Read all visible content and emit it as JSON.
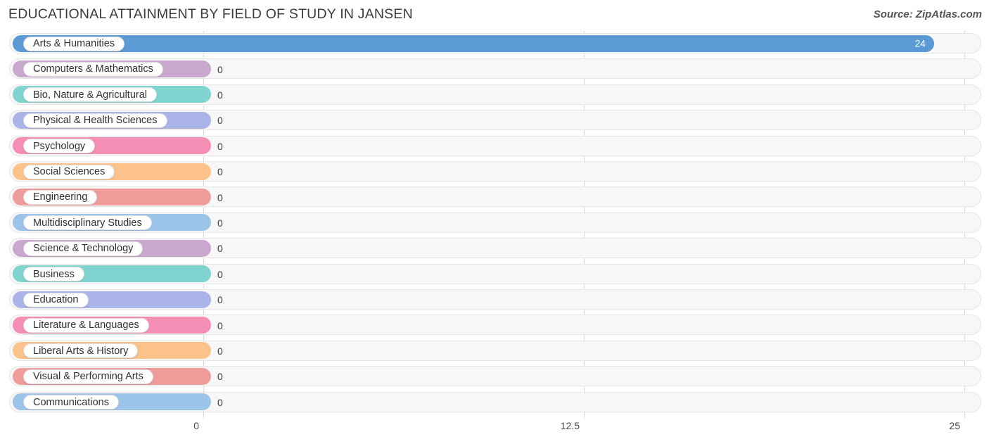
{
  "header": {
    "title": "EDUCATIONAL ATTAINMENT BY FIELD OF STUDY IN JANSEN",
    "source": "Source: ZipAtlas.com"
  },
  "chart_data": {
    "type": "bar",
    "orientation": "horizontal",
    "title": "EDUCATIONAL ATTAINMENT BY FIELD OF STUDY IN JANSEN",
    "xlabel": "",
    "ylabel": "",
    "xlim": [
      0,
      25
    ],
    "xticks": [
      "0",
      "12.5",
      "25"
    ],
    "xtick_values": [
      0,
      12.5,
      25
    ],
    "grid": true,
    "legend": "none",
    "categories": [
      "Arts & Humanities",
      "Computers & Mathematics",
      "Bio, Nature & Agricultural",
      "Physical & Health Sciences",
      "Psychology",
      "Social Sciences",
      "Engineering",
      "Multidisciplinary Studies",
      "Science & Technology",
      "Business",
      "Education",
      "Literature & Languages",
      "Liberal Arts & History",
      "Visual & Performing Arts",
      "Communications"
    ],
    "values": [
      24,
      0,
      0,
      0,
      0,
      0,
      0,
      0,
      0,
      0,
      0,
      0,
      0,
      0,
      0
    ],
    "value_labels": [
      "24",
      "0",
      "0",
      "0",
      "0",
      "0",
      "0",
      "0",
      "0",
      "0",
      "0",
      "0",
      "0",
      "0",
      "0"
    ],
    "bar_colors": [
      "#5b9bd5",
      "#c9a8cd",
      "#7fd4d0",
      "#aab4e8",
      "#f58eb4",
      "#fbc289",
      "#ef9d9b",
      "#9cc3e8",
      "#c9a8cd",
      "#7fd4d0",
      "#aab4e8",
      "#f58eb4",
      "#fbc289",
      "#ef9d9b",
      "#9cc3e8"
    ]
  },
  "colors": {
    "track_fill": "#f7f7f7",
    "track_border": "#e6e6e6",
    "gridline": "#d6d6d6",
    "text": "#3a3a3a",
    "accent": "#5b9bd5"
  }
}
